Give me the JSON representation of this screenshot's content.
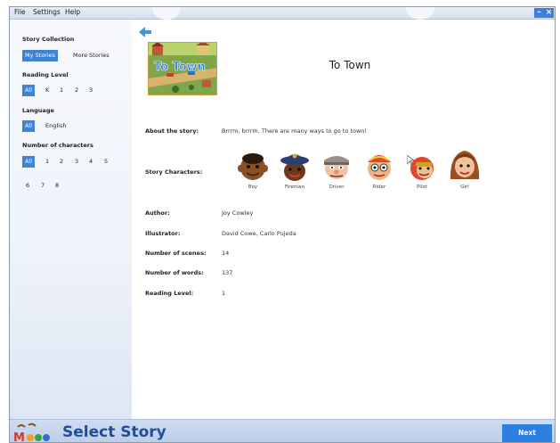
{
  "menubar": {
    "file": "File",
    "settings": "Settings",
    "help": "Help",
    "minimize": "–",
    "close": "×"
  },
  "sidebar": {
    "collection_title": "Story Collection",
    "collection_options": [
      "My Stories",
      "More Stories"
    ],
    "reading_title": "Reading Level",
    "reading_options": [
      "All",
      "K",
      "1",
      "2",
      "3"
    ],
    "language_title": "Language",
    "language_options": [
      "All",
      "English"
    ],
    "characters_title": "Number of characters",
    "characters_options": [
      "All",
      "1",
      "2",
      "3",
      "4",
      "5",
      "6",
      "7",
      "8"
    ]
  },
  "story": {
    "cover_text": "To Town",
    "title": "To Town",
    "about_label": "About the story:",
    "about_value": "Brrrm, brrrm. There are many ways to go to town!",
    "characters_label": "Story Characters:",
    "characters": [
      "Boy",
      "Fireman",
      "Driver",
      "Rider",
      "Pilot",
      "Girl"
    ],
    "author_label": "Author:",
    "author_value": "Joy Cowley",
    "illustrator_label": "Illustrator:",
    "illustrator_value": "David Cowe, Carlo Pujeda",
    "scenes_label": "Number of scenes:",
    "scenes_value": "14",
    "words_label": "Number of words:",
    "words_value": "137",
    "level_label": "Reading Level:",
    "level_value": "1"
  },
  "bottom": {
    "title": "Select Story",
    "next": "Next"
  },
  "colors": {
    "accent": "#3f83d6",
    "title_blue": "#1f4f9a",
    "next_blue": "#2d7fe0"
  }
}
